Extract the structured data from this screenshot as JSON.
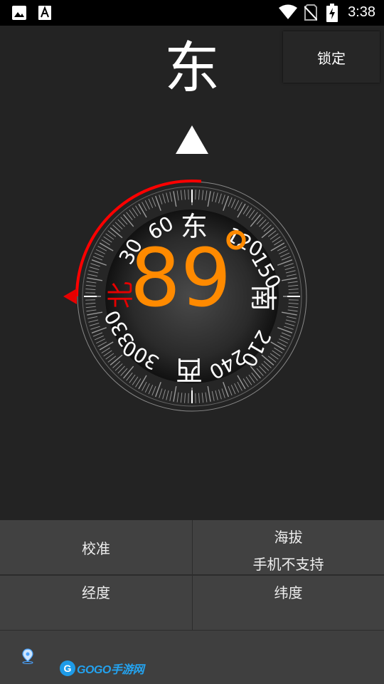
{
  "status_bar": {
    "time": "3:38",
    "icons": [
      "image-icon",
      "text-a-icon",
      "wifi-icon",
      "no-sim-icon",
      "battery-charging-icon"
    ]
  },
  "compass": {
    "direction": "东",
    "degree_value": "89",
    "degree_symbol": "°",
    "lock_label": "锁定",
    "ring_labels": {
      "east": "东",
      "south": "南",
      "west": "西",
      "north": "北",
      "d30": "30",
      "d60": "60",
      "d120": "120",
      "d150": "150",
      "d210": "210",
      "d240": "240",
      "d300": "300",
      "d330": "330"
    },
    "colors": {
      "accent": "#ff8a00",
      "north": "#e60000",
      "arc": "#ff0000"
    }
  },
  "info": {
    "calibrate": "校准",
    "altitude_label": "海拔",
    "altitude_value": "手机不支持",
    "longitude_label": "经度",
    "latitude_label": "纬度"
  },
  "footer": {
    "location_icon": "location-pin-icon",
    "logo_mark": "G",
    "logo_text": "GOGO手游网"
  }
}
